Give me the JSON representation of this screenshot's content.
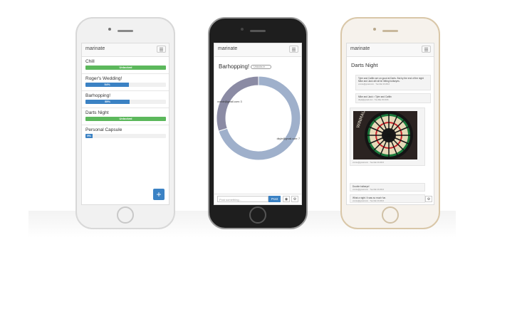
{
  "colors": {
    "success": "#5cb85c",
    "primary": "#3b82c4",
    "donut_a": "#9fb0cb",
    "donut_b": "#8b8ba4"
  },
  "list_phone": {
    "brand": "marinate",
    "items": [
      {
        "name": "Chill",
        "progress_label": "Unlocked",
        "progress": 100,
        "status": "success"
      },
      {
        "name": "Roger's Wedding!",
        "progress_label": "54%",
        "progress": 54,
        "status": "primary"
      },
      {
        "name": "Barhopping!",
        "progress_label": "55%",
        "progress": 55,
        "status": "primary"
      },
      {
        "name": "Darts Night",
        "progress_label": "Unlocked",
        "progress": 100,
        "status": "success"
      },
      {
        "name": "Personal Capsule",
        "progress_label": "9%",
        "progress": 9,
        "status": "primary"
      }
    ],
    "add_button": "+"
  },
  "chart_phone": {
    "brand": "marinate",
    "title": "Barhopping!",
    "badge": "Unlocks in …",
    "labels": [
      "vonnie@gmail.com: 3",
      "dkyle@gmail.com: 7"
    ],
    "post_placeholder": "Post something...",
    "post_button": "Post",
    "camera_icon": "camera-icon",
    "gear_icon": "gear-icon"
  },
  "chart_data": {
    "type": "pie",
    "title": "",
    "categories": [
      "vonnie@gmail.com",
      "dkyle@gmail.com"
    ],
    "values": [
      3,
      7
    ]
  },
  "chat_phone": {
    "brand": "marinate",
    "title": "Darts Night",
    "messages": [
      {
        "text": "Tyler and Caitlin are on good at Darts. But by the end of the night Mike and Jack will all be hitting bullseyes.",
        "meta": "vonnie@gmail.com · Tue Mar 29 2016"
      },
      {
        "text": "Mike and Jack > Tyler and Caitlin",
        "meta": "dkyle@gmail.com · Tue Mar 29 2016"
      },
      {
        "text": "",
        "meta": "vonnie@gmail.com · Tue Mar 29 2016"
      },
      {
        "text": "Double bullseye!",
        "meta": "vonnie@gmail.com · Tue Mar 29 2016"
      },
      {
        "text": "What a night. It was so much fun.",
        "meta": "vonnie@gmail.com · Tue Mar 29 2016"
      }
    ],
    "gear_icon": "gear-icon"
  }
}
